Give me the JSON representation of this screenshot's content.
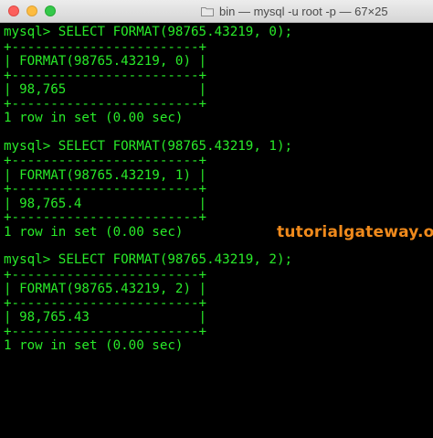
{
  "window": {
    "title": "bin — mysql -u root -p — 67×25",
    "folder_icon": "folder-icon"
  },
  "colors": {
    "terminal_text": "#29ea29",
    "background": "#000000",
    "watermark": "#f08a1c"
  },
  "blocks": [
    {
      "command": "mysql> SELECT FORMAT(98765.43219, 0);",
      "border": "+------------------------+",
      "header": "| FORMAT(98765.43219, 0) |",
      "value": "| 98,765                 |",
      "status": "1 row in set (0.00 sec)"
    },
    {
      "command": "mysql> SELECT FORMAT(98765.43219, 1);",
      "border": "+------------------------+",
      "header": "| FORMAT(98765.43219, 1) |",
      "value": "| 98,765.4               |",
      "status": "1 row in set (0.00 sec)"
    },
    {
      "command": "mysql> SELECT FORMAT(98765.43219, 2);",
      "border": "+------------------------+",
      "header": "| FORMAT(98765.43219, 2) |",
      "value": "| 98,765.43              |",
      "status": "1 row in set (0.00 sec)"
    }
  ],
  "watermark": "tutorialgateway.org"
}
